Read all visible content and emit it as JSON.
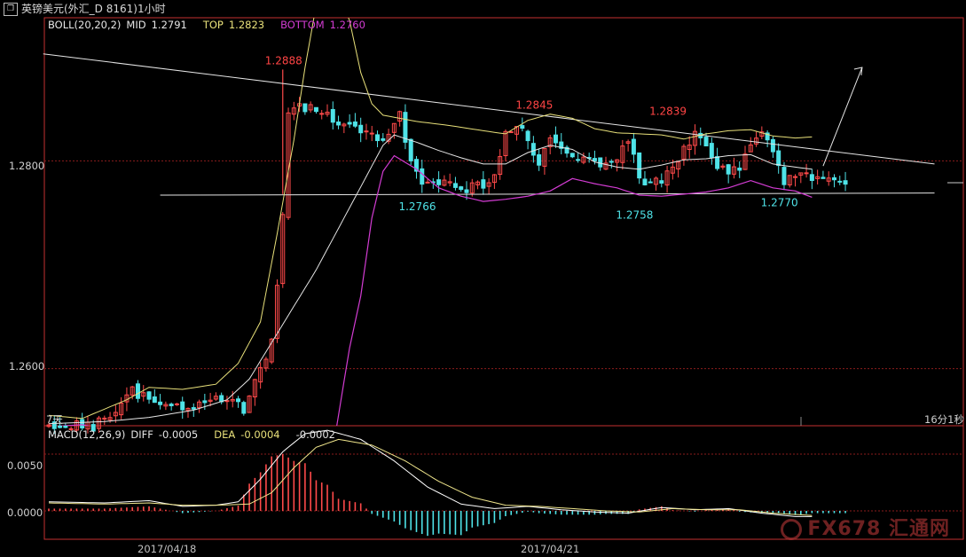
{
  "window": {
    "title": "英镑美元(外汇_D 8161)1小时",
    "icon": "window-restore-icon"
  },
  "indicators": {
    "boll": {
      "label": "BOLL(20,20,2)",
      "mid_label": "MID",
      "mid": "1.2791",
      "top_label": "TOP",
      "top": "1.2823",
      "bottom_label": "BOTTOM",
      "bottom": "1.2760"
    },
    "macd": {
      "label": "MACD(12,26,9)",
      "diff_label": "DIFF",
      "diff": "-0.0005",
      "dea_label": "DEA",
      "dea": "-0.0004",
      "macd": "-0.0002"
    }
  },
  "corners": {
    "bottom_left": "7天",
    "bottom_right": "16分1秒"
  },
  "watermark": {
    "text": "FX678 汇通网"
  },
  "colors": {
    "up": "#ff4a4a",
    "down": "#4fe3e8",
    "mid": "#e6e6e6",
    "top": "#e8e07a",
    "bottom": "#d33cd3",
    "diff": "#ffffff",
    "dea": "#f0e68c",
    "grid": "#8a1c1c",
    "annotation": "#ff4444",
    "annotation_low": "#4fe3e8"
  },
  "chart_data": {
    "type": "candlestick",
    "price_axis": {
      "ticks": [
        1.26,
        1.28
      ],
      "tick_labels": [
        "1.2600",
        "1.2800"
      ],
      "range": [
        1.2545,
        1.2925
      ]
    },
    "macd_axis": {
      "ticks": [
        0.0,
        0.005
      ],
      "tick_labels": [
        "0.0000",
        "0.0050"
      ],
      "range": [
        -0.0025,
        0.0075
      ]
    },
    "date_labels": [
      {
        "bar": 22,
        "label": "2017/04/18"
      },
      {
        "bar": 92,
        "label": "2017/04/21"
      }
    ],
    "annotations": [
      {
        "bar": 42,
        "price": 1.2888,
        "label": "1.2888",
        "kind": "high"
      },
      {
        "bar": 87,
        "price": 1.2845,
        "label": "1.2845",
        "kind": "high"
      },
      {
        "bar": 111,
        "price": 1.2839,
        "label": "1.2839",
        "kind": "high"
      },
      {
        "bar": 66,
        "price": 1.2766,
        "label": "1.2766",
        "kind": "low"
      },
      {
        "bar": 105,
        "price": 1.2758,
        "label": "1.2758",
        "kind": "low"
      },
      {
        "bar": 131,
        "price": 1.277,
        "label": "1.2770",
        "kind": "low"
      }
    ],
    "trendlines": [
      {
        "from": [
          -1,
          1.2903
        ],
        "to": [
          159,
          1.2797
        ],
        "color": "#e6e6e6"
      },
      {
        "from": [
          20,
          1.2767
        ],
        "to": [
          159,
          1.2769
        ],
        "color": "#e6e6e6"
      }
    ],
    "arrow": {
      "from": [
        139,
        1.2795
      ],
      "to": [
        146,
        1.289
      ]
    },
    "series": [
      {
        "name": "BOLL MID",
        "anchors": [
          [
            0,
            1.2547
          ],
          [
            10,
            1.2549
          ],
          [
            18,
            1.2553
          ],
          [
            26,
            1.256
          ],
          [
            32,
            1.257
          ],
          [
            36,
            1.259
          ],
          [
            40,
            1.2625
          ],
          [
            44,
            1.266
          ],
          [
            48,
            1.2695
          ],
          [
            52,
            1.2735
          ],
          [
            56,
            1.2775
          ],
          [
            60,
            1.2815
          ],
          [
            62,
            1.2825
          ],
          [
            66,
            1.2818
          ],
          [
            70,
            1.281
          ],
          [
            74,
            1.2803
          ],
          [
            78,
            1.2797
          ],
          [
            82,
            1.2797
          ],
          [
            86,
            1.2808
          ],
          [
            90,
            1.2815
          ],
          [
            94,
            1.2811
          ],
          [
            98,
            1.2799
          ],
          [
            102,
            1.2794
          ],
          [
            106,
            1.2792
          ],
          [
            110,
            1.2796
          ],
          [
            114,
            1.2801
          ],
          [
            118,
            1.2802
          ],
          [
            122,
            1.2805
          ],
          [
            126,
            1.2806
          ],
          [
            130,
            1.2797
          ],
          [
            134,
            1.2794
          ],
          [
            137,
            1.2792
          ]
        ]
      },
      {
        "name": "BOLL TOP",
        "anchors": [
          [
            0,
            1.2555
          ],
          [
            6,
            1.2552
          ],
          [
            14,
            1.257
          ],
          [
            18,
            1.2582
          ],
          [
            24,
            1.258
          ],
          [
            30,
            1.2585
          ],
          [
            34,
            1.2605
          ],
          [
            38,
            1.2645
          ],
          [
            41,
            1.273
          ],
          [
            44,
            1.282
          ],
          [
            46,
            1.289
          ],
          [
            48,
            1.295
          ],
          [
            50,
            1.2968
          ],
          [
            52,
            1.2962
          ],
          [
            54,
            1.2935
          ],
          [
            56,
            1.2885
          ],
          [
            58,
            1.2855
          ],
          [
            60,
            1.2844
          ],
          [
            66,
            1.2838
          ],
          [
            72,
            1.2834
          ],
          [
            78,
            1.2829
          ],
          [
            82,
            1.2826
          ],
          [
            86,
            1.2839
          ],
          [
            90,
            1.2845
          ],
          [
            94,
            1.2841
          ],
          [
            98,
            1.2831
          ],
          [
            102,
            1.2827
          ],
          [
            106,
            1.2826
          ],
          [
            110,
            1.2825
          ],
          [
            114,
            1.2821
          ],
          [
            118,
            1.2826
          ],
          [
            122,
            1.2829
          ],
          [
            126,
            1.283
          ],
          [
            130,
            1.2824
          ],
          [
            134,
            1.2822
          ],
          [
            137,
            1.2823
          ]
        ]
      },
      {
        "name": "BOLL BOTTOM",
        "anchors": [
          [
            0,
            1.2544
          ],
          [
            6,
            1.2546
          ],
          [
            14,
            1.2537
          ],
          [
            20,
            1.2535
          ],
          [
            26,
            1.254
          ],
          [
            32,
            1.2535
          ],
          [
            38,
            1.251
          ],
          [
            42,
            1.245
          ],
          [
            45,
            1.243
          ],
          [
            48,
            1.244
          ],
          [
            50,
            1.249
          ],
          [
            52,
            1.2555
          ],
          [
            54,
            1.262
          ],
          [
            56,
            1.267
          ],
          [
            58,
            1.2745
          ],
          [
            60,
            1.279
          ],
          [
            62,
            1.2805
          ],
          [
            66,
            1.2792
          ],
          [
            70,
            1.2774
          ],
          [
            74,
            1.2766
          ],
          [
            78,
            1.2761
          ],
          [
            82,
            1.2763
          ],
          [
            86,
            1.2766
          ],
          [
            90,
            1.2771
          ],
          [
            94,
            1.2783
          ],
          [
            98,
            1.2778
          ],
          [
            102,
            1.2774
          ],
          [
            106,
            1.2767
          ],
          [
            110,
            1.2766
          ],
          [
            114,
            1.2768
          ],
          [
            118,
            1.277
          ],
          [
            122,
            1.2774
          ],
          [
            126,
            1.2781
          ],
          [
            130,
            1.2774
          ],
          [
            134,
            1.2771
          ],
          [
            137,
            1.2765
          ]
        ]
      },
      {
        "name": "DIFF",
        "anchors": [
          [
            0,
            0.0008
          ],
          [
            10,
            0.0007
          ],
          [
            18,
            0.0009
          ],
          [
            24,
            0.0004
          ],
          [
            30,
            0.0005
          ],
          [
            34,
            0.0008
          ],
          [
            38,
            0.0028
          ],
          [
            42,
            0.0052
          ],
          [
            46,
            0.0068
          ],
          [
            50,
            0.0071
          ],
          [
            56,
            0.0063
          ],
          [
            62,
            0.0044
          ],
          [
            68,
            0.0021
          ],
          [
            74,
            0.0006
          ],
          [
            80,
            0.0002
          ],
          [
            86,
            0.0004
          ],
          [
            92,
            0.0001
          ],
          [
            98,
            -0.0001
          ],
          [
            104,
            -0.0002
          ],
          [
            110,
            0.0003
          ],
          [
            116,
            0.0001
          ],
          [
            122,
            0.0002
          ],
          [
            128,
            -0.0002
          ],
          [
            134,
            -0.0005
          ],
          [
            137,
            -0.0005
          ]
        ]
      },
      {
        "name": "DEA",
        "anchors": [
          [
            0,
            0.0007
          ],
          [
            10,
            0.0006
          ],
          [
            18,
            0.0007
          ],
          [
            24,
            0.0005
          ],
          [
            30,
            0.0005
          ],
          [
            36,
            0.0006
          ],
          [
            40,
            0.0016
          ],
          [
            44,
            0.0038
          ],
          [
            48,
            0.0056
          ],
          [
            52,
            0.0063
          ],
          [
            58,
            0.0058
          ],
          [
            64,
            0.0044
          ],
          [
            70,
            0.0026
          ],
          [
            76,
            0.0012
          ],
          [
            82,
            0.0005
          ],
          [
            88,
            0.0004
          ],
          [
            94,
            0.0002
          ],
          [
            100,
            0.0
          ],
          [
            106,
            -0.0001
          ],
          [
            112,
            0.0002
          ],
          [
            118,
            0.0001
          ],
          [
            124,
            0.0001
          ],
          [
            130,
            -0.0002
          ],
          [
            137,
            -0.0004
          ]
        ]
      },
      {
        "name": "Price",
        "ohlc_seed": 20170418,
        "close_anchors": [
          [
            0,
            1.2547
          ],
          [
            8,
            1.2543
          ],
          [
            11,
            1.2555
          ],
          [
            14,
            1.2572
          ],
          [
            15,
            1.2578
          ],
          [
            18,
            1.2568
          ],
          [
            20,
            1.2565
          ],
          [
            26,
            1.2566
          ],
          [
            30,
            1.2569
          ],
          [
            33,
            1.2575
          ],
          [
            35,
            1.2556
          ],
          [
            36,
            1.2578
          ],
          [
            40,
            1.2625
          ],
          [
            41,
            1.2676
          ],
          [
            42,
            1.2745
          ],
          [
            43,
            1.2843
          ],
          [
            44,
            1.2852
          ],
          [
            46,
            1.2851
          ],
          [
            48,
            1.2848
          ],
          [
            50,
            1.2846
          ],
          [
            52,
            1.2835
          ],
          [
            56,
            1.2832
          ],
          [
            58,
            1.2826
          ],
          [
            60,
            1.2815
          ],
          [
            62,
            1.2835
          ],
          [
            63,
            1.2848
          ],
          [
            64,
            1.2817
          ],
          [
            66,
            1.279
          ],
          [
            68,
            1.2776
          ],
          [
            72,
            1.2778
          ],
          [
            74,
            1.2773
          ],
          [
            78,
            1.2776
          ],
          [
            80,
            1.2788
          ],
          [
            82,
            1.2825
          ],
          [
            84,
            1.2833
          ],
          [
            86,
            1.2823
          ],
          [
            88,
            1.2795
          ],
          [
            90,
            1.2825
          ],
          [
            92,
            1.2812
          ],
          [
            94,
            1.2803
          ],
          [
            96,
            1.2802
          ],
          [
            98,
            1.2795
          ],
          [
            100,
            1.2793
          ],
          [
            102,
            1.2806
          ],
          [
            104,
            1.2823
          ],
          [
            106,
            1.2781
          ],
          [
            108,
            1.278
          ],
          [
            110,
            1.2778
          ],
          [
            112,
            1.2796
          ],
          [
            114,
            1.2812
          ],
          [
            116,
            1.2828
          ],
          [
            118,
            1.2818
          ],
          [
            120,
            1.2793
          ],
          [
            122,
            1.2792
          ],
          [
            124,
            1.2796
          ],
          [
            126,
            1.2812
          ],
          [
            128,
            1.2825
          ],
          [
            130,
            1.2806
          ],
          [
            132,
            1.278
          ],
          [
            134,
            1.2782
          ],
          [
            136,
            1.2786
          ],
          [
            138,
            1.2784
          ],
          [
            140,
            1.2783
          ],
          [
            142,
            1.2776
          ],
          [
            143,
            1.2782
          ]
        ]
      }
    ],
    "bars": 144
  }
}
